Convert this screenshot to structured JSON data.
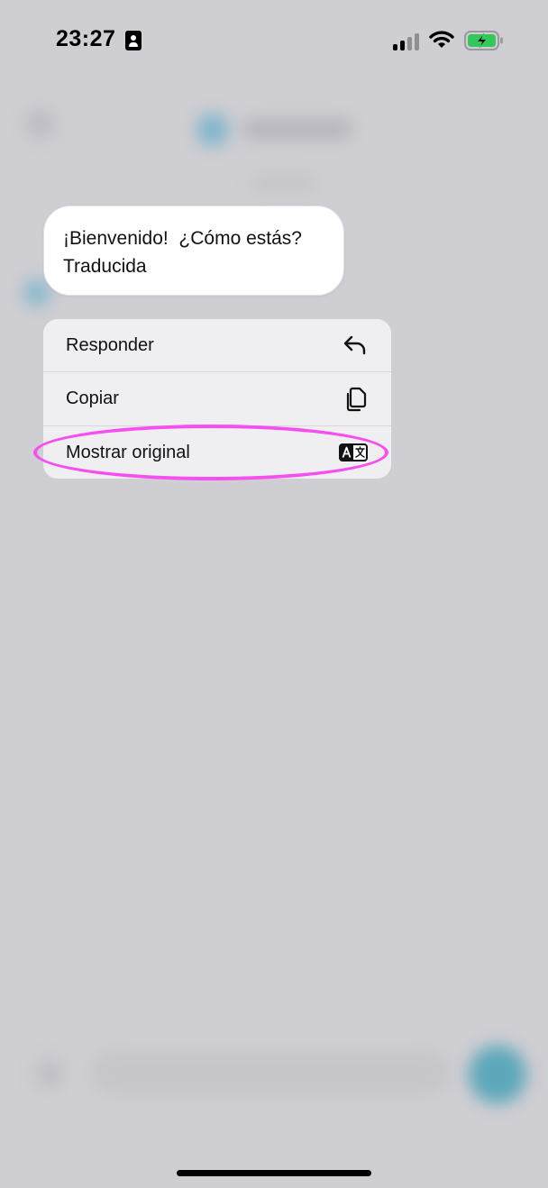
{
  "status_bar": {
    "time": "23:27",
    "id_icon": "person-card-icon",
    "signal_icon": "cellular-signal-icon",
    "wifi_icon": "wifi-icon",
    "battery_icon": "battery-charging-icon",
    "battery_color": "#34c759"
  },
  "message": {
    "text": "¡Bienvenido!  ¿Cómo estás?",
    "translation_label": "Traducida"
  },
  "context_menu": {
    "items": [
      {
        "label": "Responder",
        "icon": "reply-arrow-icon"
      },
      {
        "label": "Copiar",
        "icon": "copy-icon"
      },
      {
        "label": "Mostrar original",
        "icon": "translate-icon"
      }
    ]
  },
  "highlight": {
    "target": "Mostrar original",
    "color": "#f64ff0"
  },
  "colors": {
    "background": "#cfced3",
    "menu_background": "#efeff2",
    "bubble_background": "#ffffff",
    "accent_blurred": "#5ba7b9"
  }
}
